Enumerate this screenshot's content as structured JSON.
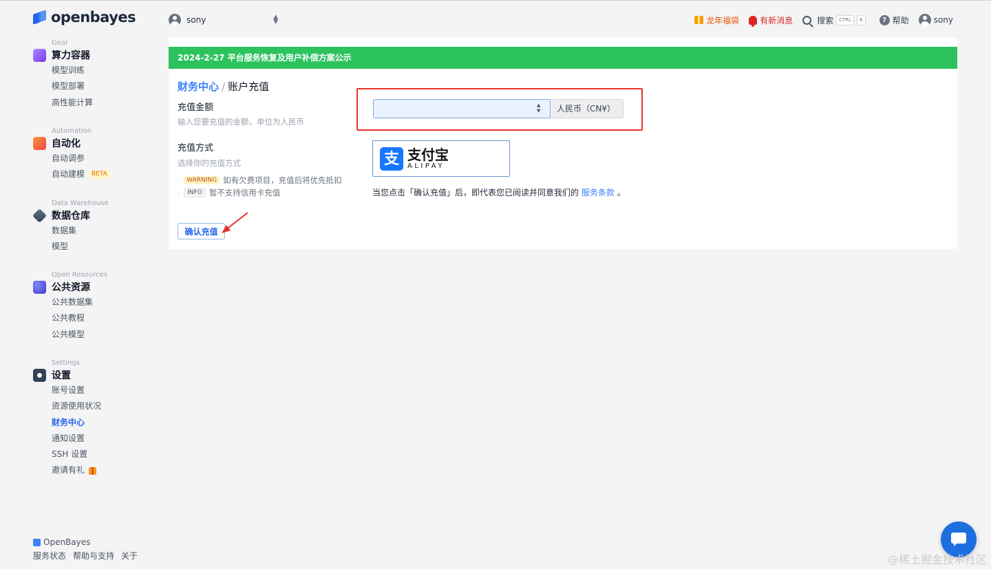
{
  "brand": {
    "logo_text": "openbayes",
    "footer_name": "OpenBayes"
  },
  "sidebar": {
    "groups": [
      {
        "eyebrow": "Gear",
        "title": "算力容器",
        "icon": "container-icon",
        "items": [
          {
            "label": "模型训练"
          },
          {
            "label": "模型部署"
          },
          {
            "label": "高性能计算"
          }
        ]
      },
      {
        "eyebrow": "Automation",
        "title": "自动化",
        "icon": "automation-icon",
        "items": [
          {
            "label": "自动调参"
          },
          {
            "label": "自动建模",
            "badge": "BETA"
          }
        ]
      },
      {
        "eyebrow": "Data Warehouse",
        "title": "数据仓库",
        "icon": "warehouse-icon",
        "items": [
          {
            "label": "数据集"
          },
          {
            "label": "模型"
          }
        ]
      },
      {
        "eyebrow": "Open Resources",
        "title": "公共资源",
        "icon": "open-resources-icon",
        "items": [
          {
            "label": "公共数据集"
          },
          {
            "label": "公共教程"
          },
          {
            "label": "公共模型"
          }
        ]
      },
      {
        "eyebrow": "Settings",
        "title": "设置",
        "icon": "settings-icon",
        "items": [
          {
            "label": "账号设置"
          },
          {
            "label": "资源使用状况"
          },
          {
            "label": "财务中心",
            "active": true
          },
          {
            "label": "通知设置"
          },
          {
            "label": "SSH 设置"
          },
          {
            "label": "邀请有礼"
          }
        ]
      }
    ],
    "footer_links": [
      "服务状态",
      "帮助与支持",
      "关于"
    ]
  },
  "topbar": {
    "account": "sony",
    "fortune_bag": "龙年福袋",
    "messages": "有新消息",
    "search": "搜索",
    "search_kbd_1": "CTRL",
    "search_kbd_2": "K",
    "help": "帮助",
    "user": "sony"
  },
  "notice": "2024-2-27 平台服务恢复及用户补偿方案公示",
  "breadcrumb": {
    "parent": "财务中心",
    "separator": "/",
    "current": "账户充值"
  },
  "form": {
    "amount_label": "充值金额",
    "amount_hint": "输入您要充值的金额，单位为人民币",
    "amount_value": "",
    "currency": "人民币（CN¥）",
    "method_label": "充值方式",
    "method_hint": "选择你的充值方式",
    "alipay_zh": "支付宝",
    "alipay_en": "ALIPAY",
    "alipay_glyph": "支",
    "warning_tag": "WARNING",
    "warning_text": "如有欠费项目，充值后将优先抵扣",
    "info_tag": "INFO",
    "info_text": "暂不支持信用卡充值",
    "agree_prefix": "当您点击「确认充值」后，即代表您已阅读并同意我们的",
    "agree_link": "服务条款",
    "agree_suffix": "。",
    "confirm_button": "确认充值"
  },
  "watermark": "@稀土掘金技术社区",
  "colors": {
    "accent": "#3b82f6",
    "notice_bg": "#2cc35e",
    "annotation": "#e5322d",
    "alipay": "#1677ff"
  }
}
